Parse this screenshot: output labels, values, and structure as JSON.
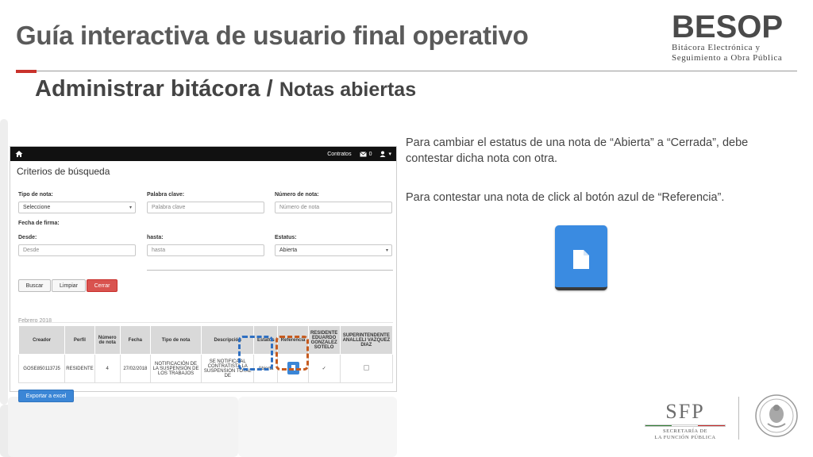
{
  "header": {
    "title": "Guía interactiva de usuario final operativo",
    "subtitle_main": "Administrar bitácora / ",
    "subtitle_small": "Notas abiertas"
  },
  "logo": {
    "mark": "BESOP",
    "line1": "Bitácora Electrónica y",
    "line2": "Seguimiento a Obra Pública"
  },
  "screenshot": {
    "nav": {
      "contracts": "Contratos",
      "messages_count": "0"
    },
    "criteria_title": "Criterios de búsqueda",
    "fields": {
      "tipo_label": "Tipo de nota:",
      "tipo_value": "Seleccione",
      "palabra_label": "Palabra clave:",
      "palabra_placeholder": "Palabra clave",
      "numero_label": "Número de nota:",
      "numero_placeholder": "Número de nota",
      "fecha_label": "Fecha de firma:",
      "desde_label": "Desde:",
      "desde_placeholder": "Desde",
      "hasta_label": "hasta:",
      "hasta_placeholder": "hasta",
      "estatus_label": "Estatus:",
      "estatus_value": "Abierta"
    },
    "buttons": {
      "buscar": "Buscar",
      "limpiar": "Limpiar",
      "cerrar": "Cerrar",
      "exportar": "Exportar a excel"
    },
    "month": "Febrero 2018",
    "table": {
      "headers": [
        "Creador",
        "Perfil",
        "Número de nota",
        "Fecha",
        "Tipo de nota",
        "Descripción",
        "Estatus",
        "Referencia",
        "RESIDENTE EDUARDO GONZALEZ SOTELO",
        "SUPERINTENDENTE ANALLELI VAZQUEZ DIAZ"
      ],
      "row": {
        "creador": "GOSE8501137J5",
        "perfil": "RESIDENTE",
        "numero": "4",
        "fecha": "27/02/2018",
        "tipo": "NOTIFICACIÓN DE LA SUSPENSIÓN DE LOS TRABAJOS",
        "descripcion": "SE NOTIFICA AL CONTRATISTA LA SUSPENSION TOTAL DE",
        "estatus": "Abierta",
        "residente_mark": "✓"
      }
    }
  },
  "instructions": {
    "p1": "Para cambiar el estatus de una nota de “Abierta” a “Cerrada”, debe contestar dicha nota con otra.",
    "p2": "Para contestar una nota de click al botón azul de “Referencia”."
  },
  "footer": {
    "sfp_mark": "SFP",
    "sfp_line1": "SECRETARÍA DE",
    "sfp_line2": "LA FUNCIÓN PÚBLICA"
  },
  "colors": {
    "accent_red": "#c9322c",
    "reference_blue": "#3a8be1",
    "highlight_blue": "#2e6fc1",
    "highlight_orange": "#c65a1e"
  },
  "icons": [
    "home-icon",
    "envelope-icon",
    "user-icon",
    "document-icon",
    "checkbox-icon",
    "seal-icon"
  ]
}
